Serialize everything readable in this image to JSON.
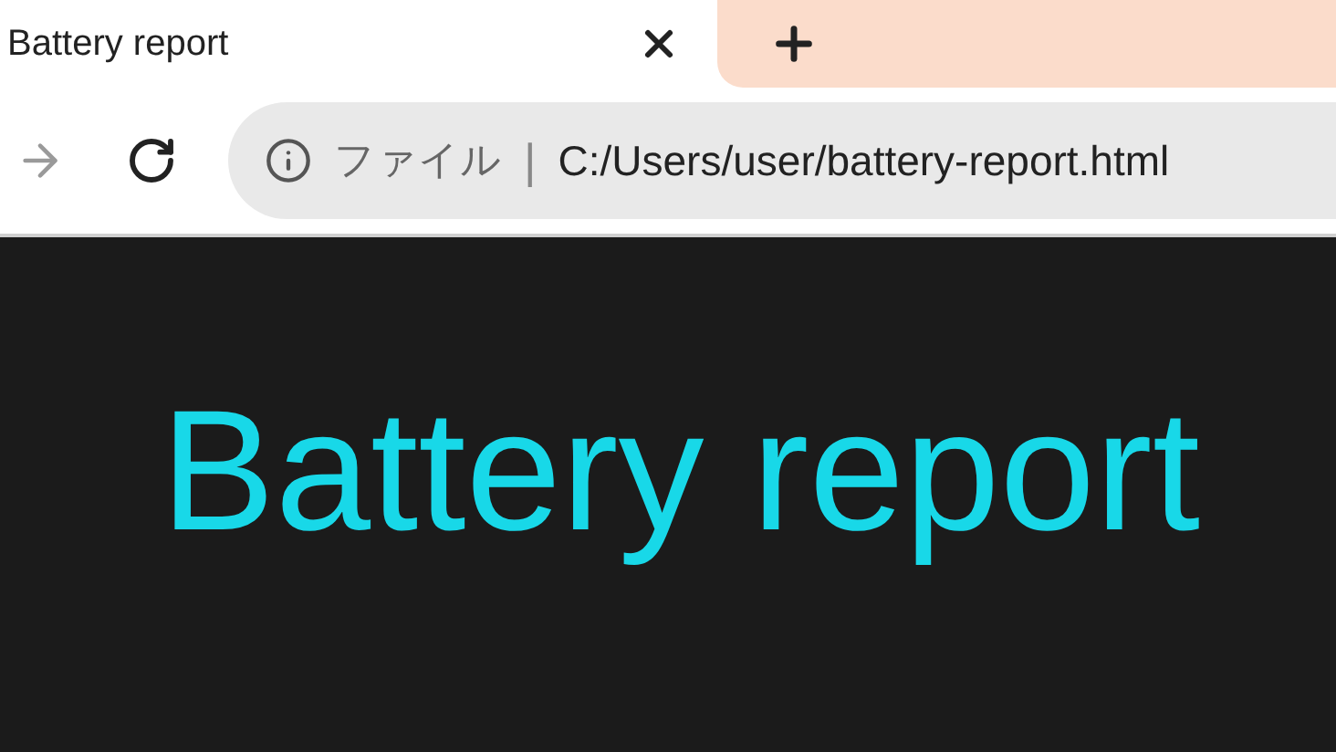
{
  "tab": {
    "title": "Battery report"
  },
  "address_bar": {
    "scheme_label": "ファイル",
    "separator": "|",
    "url": "C:/Users/user/battery-report.html"
  },
  "page": {
    "heading": "Battery report"
  }
}
